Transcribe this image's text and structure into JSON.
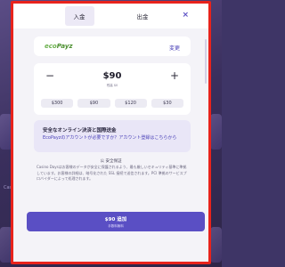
{
  "tabs": [
    {
      "label": "入金",
      "active": true
    },
    {
      "label": "出金",
      "active": false
    }
  ],
  "close_icon": "×",
  "provider": {
    "logo_prefix": "eco",
    "logo_suffix": "Payz",
    "change_label": "変更"
  },
  "amount": {
    "minus_icon": "−",
    "plus_icon": "+",
    "value": "$90",
    "subtext": "残高 $0",
    "chips": [
      "$300",
      "$90",
      "$120",
      "$30"
    ]
  },
  "info": {
    "title": "安全なオンライン決済と国際送金",
    "link_text": "EcoPayzのアカウントが必要ですか？アカウント登録はこちらから"
  },
  "safety": {
    "title": "公 安全保証",
    "text": "Casino Daysはお客様のデータが安全に保護されるよう、最も厳しいセキュリティ基準に準拠しています。お客様の詳細は、暗号化された SSL 接続で送信されます。PCI 準拠のサービスプロバイダーによって処理されます。"
  },
  "submit": {
    "label": "$90 追加",
    "sublabel": "手数料無料"
  },
  "background": {
    "side_text": "Casino"
  },
  "colors": {
    "accent": "#5a4fc4",
    "frame": "#e8231c",
    "brand_green": "#4a8f2e"
  }
}
